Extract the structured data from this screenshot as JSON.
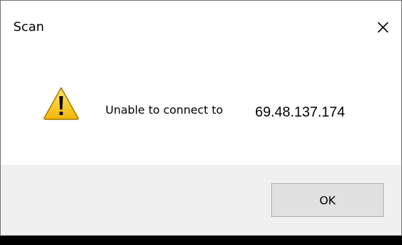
{
  "window": {
    "title": "Scan",
    "close_icon": "close-icon"
  },
  "message": {
    "icon": "warning-icon",
    "text": "Unable to connect to",
    "address": "69.48.137.174"
  },
  "buttons": {
    "ok_label": "OK"
  },
  "colors": {
    "dialog_background": "#ffffff",
    "footer_background": "#f0f0f0",
    "button_background": "#e1e1e1",
    "button_border": "#adadad",
    "warning_yellow": "#f5c518"
  }
}
